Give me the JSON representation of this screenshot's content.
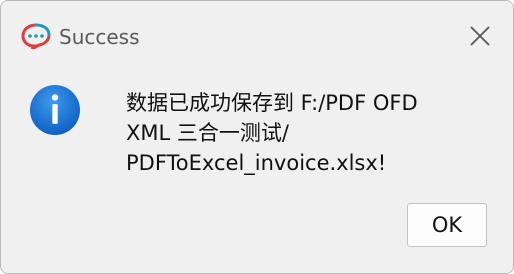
{
  "window": {
    "title": "Success",
    "app_icon": "chat-bubble-icon",
    "close_icon": "close-icon"
  },
  "dialog": {
    "icon": "info-icon",
    "message": "数据已成功保存到 F:/PDF OFD\nXML 三合一测试/\nPDFToExcel_invoice.xlsx!",
    "ok_label": "OK"
  },
  "colors": {
    "background": "#f0f0f0",
    "info_blue": "#1a74d6",
    "app_icon_red": "#e23b3b",
    "app_icon_teal": "#1f9bb5"
  }
}
